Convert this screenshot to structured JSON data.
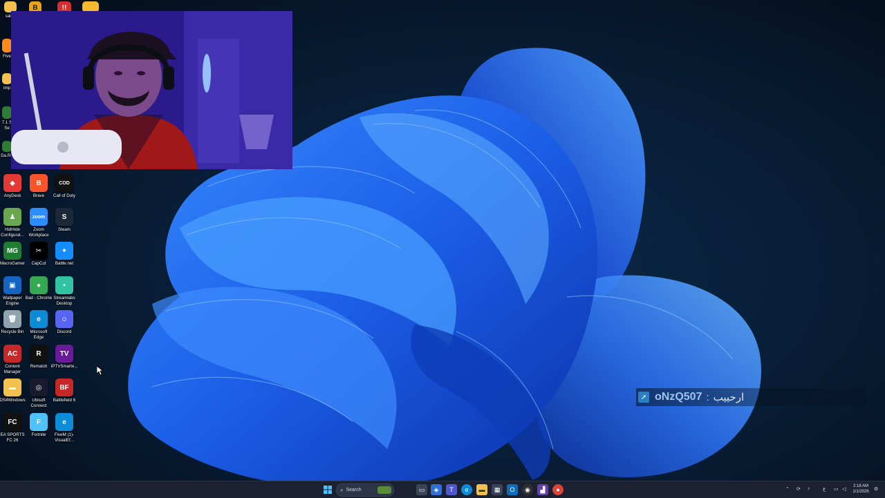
{
  "desktop": {
    "partial_top_icons": [
      {
        "label": "saleh",
        "icon": "folder-icon"
      },
      {
        "label": "Five",
        "icon": "app-icon"
      },
      {
        "label": "imp",
        "icon": "folder-icon"
      },
      {
        "label": "7.1 S Se",
        "icon": "app-icon"
      },
      {
        "label": "Da Re",
        "icon": "app-icon"
      }
    ],
    "icons": [
      {
        "label": "AnyDesk",
        "icon": "anydesk-icon",
        "color": "#e53935"
      },
      {
        "label": "Brave",
        "icon": "brave-icon",
        "color": "#fb542b"
      },
      {
        "label": "Call of Duty",
        "icon": "call-of-duty-icon",
        "color": "#111111"
      },
      {
        "label": "HidHide Configurat...",
        "icon": "hidhide-icon",
        "color": "#6aa84f"
      },
      {
        "label": "Zoom Workplace",
        "icon": "zoom-icon",
        "color": "#2d8cff"
      },
      {
        "label": "Steam",
        "icon": "steam-icon",
        "color": "#1b2838"
      },
      {
        "label": "MacroGamer",
        "icon": "macrogamer-icon",
        "color": "#1e7d32"
      },
      {
        "label": "CapCut",
        "icon": "capcut-icon",
        "color": "#000000"
      },
      {
        "label": "Battle.net",
        "icon": "battlenet-icon",
        "color": "#148eff"
      },
      {
        "label": "Wallpaper Engine",
        "icon": "wallpaper-engine-icon",
        "color": "#1565c0"
      },
      {
        "label": "Bad - Chrome",
        "icon": "chrome-icon",
        "color": "#34a853"
      },
      {
        "label": "Streamlabs Desktop",
        "icon": "streamlabs-icon",
        "color": "#31c3a2"
      },
      {
        "label": "Recycle Bin",
        "icon": "recycle-bin-icon",
        "color": "#90a4ae"
      },
      {
        "label": "Microsoft Edge",
        "icon": "edge-icon",
        "color": "#0c8bd6"
      },
      {
        "label": "Discord",
        "icon": "discord-icon",
        "color": "#5865f2"
      },
      {
        "label": "Content Manager",
        "icon": "content-manager-icon",
        "color": "#c62828"
      },
      {
        "label": "Rematch",
        "icon": "rematch-icon",
        "color": "#101010"
      },
      {
        "label": "IPTVSmarte...",
        "icon": "iptv-icon",
        "color": "#6a1b9a"
      },
      {
        "label": "DS4Windows",
        "icon": "folder-icon",
        "color": "#f2c14e"
      },
      {
        "label": "Ubisoft Connect",
        "icon": "ubisoft-icon",
        "color": "#1a1a2e"
      },
      {
        "label": "Battlefield 6",
        "icon": "battlefield-icon",
        "color": "#c62828"
      },
      {
        "label": "EA SPORTS FC 26",
        "icon": "ea-fc-icon",
        "color": "#111111"
      },
      {
        "label": "Fortnite",
        "icon": "fortnite-icon",
        "color": "#4fc3f7"
      },
      {
        "label": "FiveM (1)-VisualEf...",
        "icon": "edge-icon",
        "color": "#0c8bd6"
      }
    ],
    "icon_glyphs": {
      "AnyDesk": "◆",
      "Brave": "B",
      "Call of Duty": "COD",
      "HidHide Configurat...": "♟",
      "Zoom Workplace": "zoom",
      "Steam": "S",
      "MacroGamer": "MG",
      "CapCut": "✂",
      "Battle.net": "✦",
      "Wallpaper Engine": "▣",
      "Bad - Chrome": "●",
      "Streamlabs Desktop": "▪",
      "Recycle Bin": "🗑",
      "Microsoft Edge": "e",
      "Discord": "☺",
      "Content Manager": "AC",
      "Rematch": "R",
      "IPTVSmarte...": "TV",
      "DS4Windows": "▬",
      "Ubisoft Connect": "◎",
      "Battlefield 6": "BF",
      "EA SPORTS FC 26": "FC",
      "Fortnite": "F",
      "FiveM (1)-VisualEf...": "e"
    }
  },
  "chat_overlay": {
    "username": "oNzQ507",
    "separator": ":",
    "message": "ارحييب"
  },
  "taskbar": {
    "search_placeholder": "Search",
    "apps": [
      "start-icon",
      "task-view-icon",
      "copilot-icon",
      "teams-icon",
      "edge-icon",
      "file-explorer-icon",
      "store-icon",
      "outlook-icon",
      "obs-icon",
      "twitch-icon",
      "chrome-icon"
    ],
    "clock_time": "2:18 AM",
    "clock_date": "1/1/2026"
  },
  "colors": {
    "wallpaper_bg": "#06101e",
    "bloom_blue": "#1f5fe0",
    "taskbar": "#1b2130"
  }
}
